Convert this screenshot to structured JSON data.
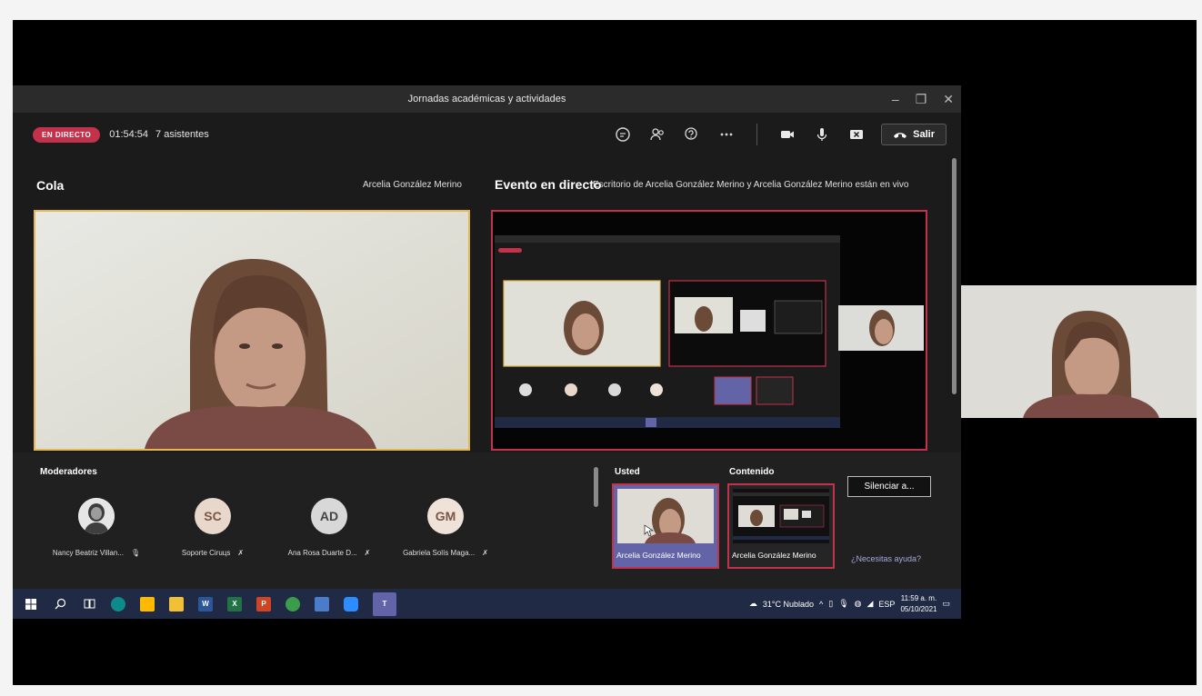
{
  "window": {
    "title": "Jornadas académicas y actividades",
    "minimize": "–",
    "maximize": "❐",
    "close": "✕"
  },
  "meeting": {
    "live_badge": "EN DIRECTO",
    "timer": "01:54:54",
    "attendees": "7 asistentes",
    "leave_label": "Salir"
  },
  "queue": {
    "title": "Cola",
    "presenter": "Arcelia González Merino"
  },
  "live_event": {
    "title": "Evento en directo",
    "description": "Escritorio de Arcelia González Merino y Arcelia González Merino están en vivo"
  },
  "moderators": {
    "title": "Moderadores",
    "items": [
      {
        "name": "Nancy Beatriz Villan...",
        "initials": "",
        "avatar_color": "#e6e6e6",
        "mic_state": "on"
      },
      {
        "name": "Soporte Ciruцs",
        "initials": "SC",
        "avatar_color": "#e8d8cc",
        "mic_state": "muted"
      },
      {
        "name": "Ana Rosa Duarte D...",
        "initials": "AD",
        "avatar_color": "#d8d8d8",
        "mic_state": "muted"
      },
      {
        "name": "Gabriela Solís Maga...",
        "initials": "GM",
        "avatar_color": "#efe2d8",
        "mic_state": "muted"
      }
    ]
  },
  "panels": {
    "usted_title": "Usted",
    "contenido_title": "Contenido",
    "usted_name": "Arcelia González Merino",
    "contenido_name": "Arcelia González Merino",
    "mute_all_label": "Silenciar a...",
    "help_label": "¿Necesitas ayuda?"
  },
  "taskbar": {
    "weather": "31°C Nublado",
    "language": "ESP",
    "time": "11:59 a. m.",
    "date": "05/10/2021"
  },
  "colors": {
    "live_red": "#c4314b",
    "queue_gold": "#e3b84e",
    "teams_purple": "#6264a7",
    "taskbar": "#202a44"
  }
}
